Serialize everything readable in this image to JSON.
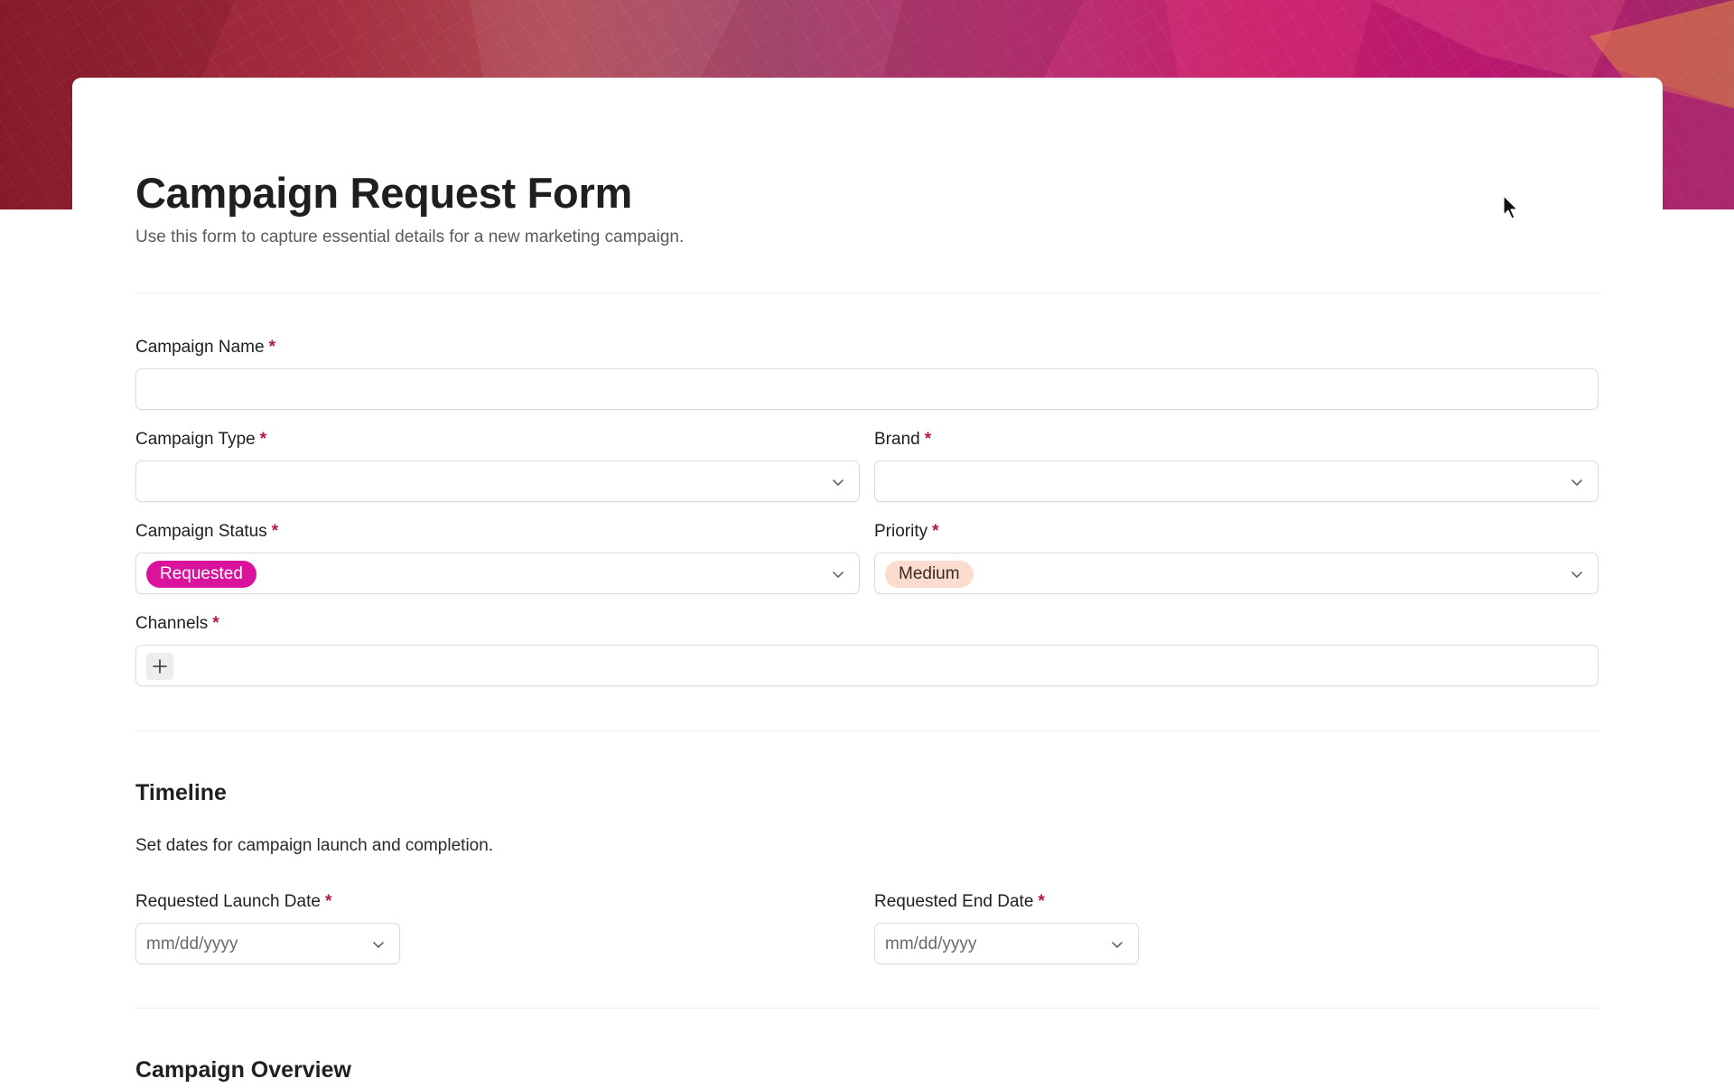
{
  "form": {
    "title": "Campaign Request Form",
    "subtitle": "Use this form to capture essential details for a new marketing campaign."
  },
  "fields": {
    "campaign_name": {
      "label": "Campaign Name",
      "value": ""
    },
    "campaign_type": {
      "label": "Campaign Type",
      "value": ""
    },
    "brand": {
      "label": "Brand",
      "value": ""
    },
    "campaign_status": {
      "label": "Campaign Status",
      "value": "Requested"
    },
    "priority": {
      "label": "Priority",
      "value": "Medium"
    },
    "channels": {
      "label": "Channels"
    },
    "required_mark": "*"
  },
  "timeline": {
    "heading": "Timeline",
    "description": "Set dates for campaign launch and completion.",
    "launch_date": {
      "label": "Requested Launch Date",
      "placeholder": "mm/dd/yyyy"
    },
    "end_date": {
      "label": "Requested End Date",
      "placeholder": "mm/dd/yyyy"
    }
  },
  "overview": {
    "heading": "Campaign Overview"
  },
  "colors": {
    "required": "#b0174a",
    "status_requested_bg": "#d9139c",
    "priority_medium_bg": "#fbdccf",
    "cover_accent": "#c21e6a"
  },
  "icons": {
    "select": "chevron-down-icon",
    "add": "plus-icon",
    "pointer": "mouse-cursor-icon"
  }
}
